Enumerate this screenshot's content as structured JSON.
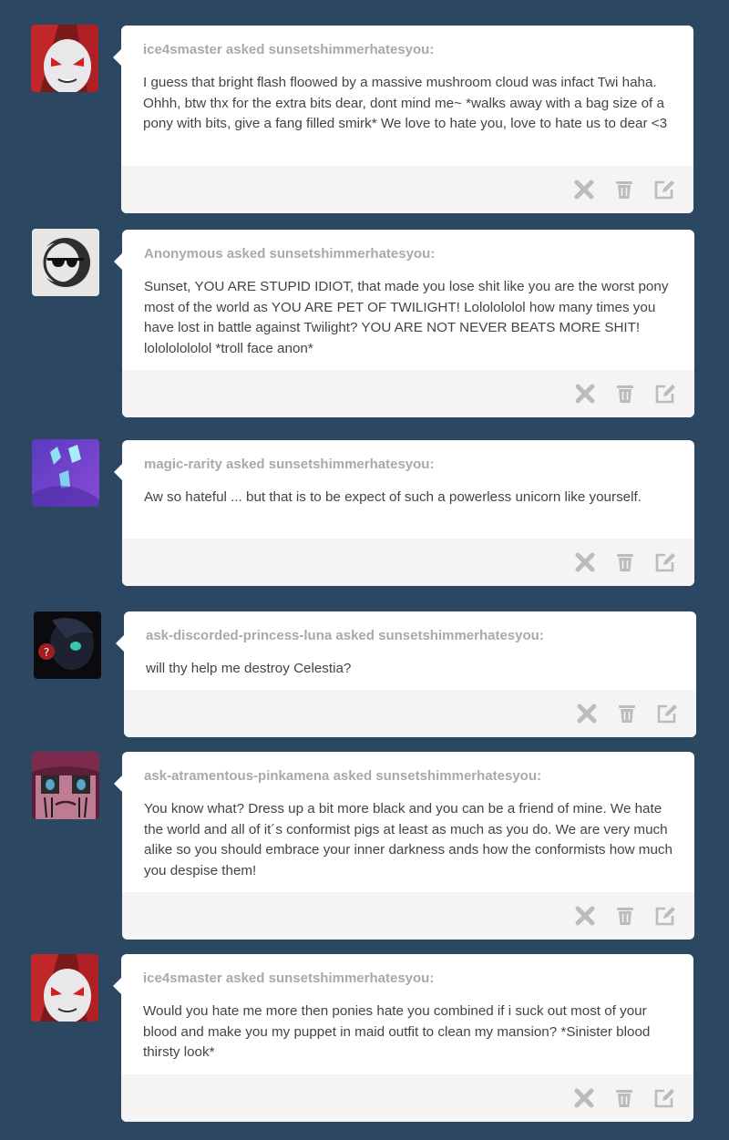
{
  "posts": [
    {
      "asker": "ice4smaster asked sunsetshimmerhatesyou:",
      "question": "I guess that bright flash floowed by a massive mushroom cloud was infact Twi haha. Ohhh, btw thx for the extra bits dear, dont mind me~ *walks away with a bag size of a pony with bits, give a fang filled smirk* We love to hate you, love to hate us to dear <3",
      "avatar_icon": "red-eyed-pony-avatar"
    },
    {
      "asker": "Anonymous asked sunsetshimmerhatesyou:",
      "question": "Sunset, YOU ARE STUPID IDIOT, that made you lose shit like you are the worst pony most of the world as YOU ARE PET OF TWILIGHT! Lololololol how many times you have lost in battle against Twilight? YOU ARE NOT NEVER BEATS MORE SHIT! lolololololol *troll face anon*",
      "avatar_icon": "anonymous-sunglasses-avatar"
    },
    {
      "asker": "magic-rarity asked sunsetshimmerhatesyou:",
      "question": "Aw so hateful ... but that is to be expect of such a powerless unicorn like yourself.",
      "avatar_icon": "rarity-gems-avatar"
    },
    {
      "asker": "ask-discorded-princess-luna asked sunsetshimmerhatesyou:",
      "question": "will thy help me destroy Celestia?",
      "avatar_icon": "dark-luna-avatar"
    },
    {
      "asker": "ask-atramentous-pinkamena asked sunsetshimmerhatesyou:",
      "question": "You know what? Dress up a bit more black and you can be a friend of mine. We hate the world and all of it´s conformist pigs at least as much as you do. We are very much alike so you should embrace your inner darkness ands how the conformists how much you despise them!",
      "avatar_icon": "pinkamena-avatar"
    },
    {
      "asker": "ice4smaster asked sunsetshimmerhatesyou:",
      "question": "Would you hate me more then ponies hate you combined if i suck out most of your blood and make you my puppet in maid outfit to clean my mansion? *Sinister blood thirsty look*",
      "avatar_icon": "red-eyed-pony-avatar"
    }
  ],
  "actions": [
    "delete-x-icon",
    "trash-icon",
    "edit-icon"
  ],
  "colors": {
    "background": "#2c4762",
    "card": "#ffffff",
    "footer": "#f4f4f4",
    "asker": "#a9a9a9",
    "text": "#444444",
    "icon": "#bcbcbc"
  }
}
